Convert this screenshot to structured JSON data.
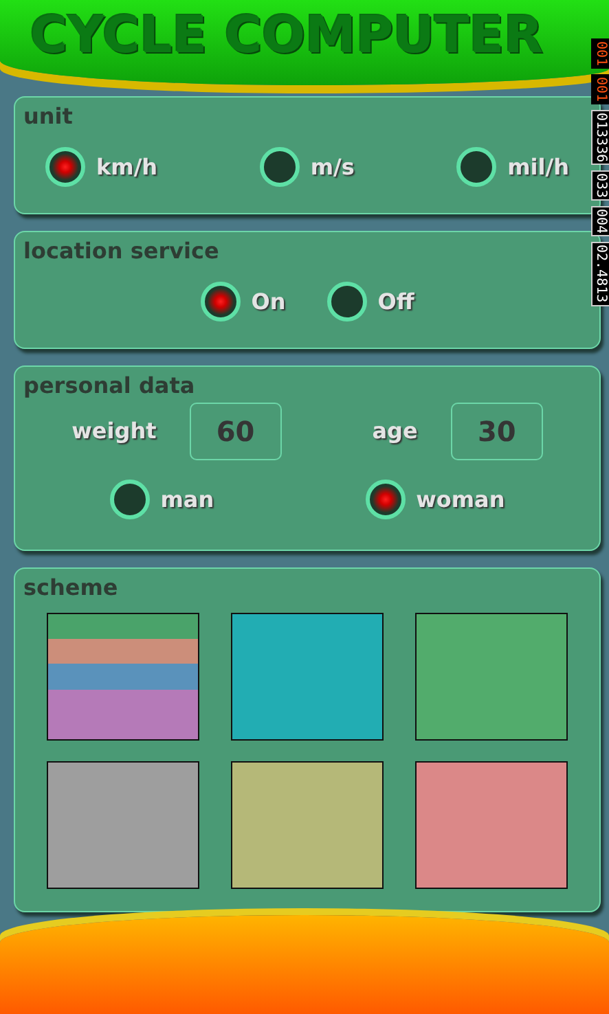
{
  "header": {
    "title": "CYCLE COMPUTER"
  },
  "counters": [
    "001",
    "001",
    "013336",
    "033",
    "004",
    "02.4813"
  ],
  "unit": {
    "title": "unit",
    "options": [
      {
        "label": "km/h",
        "selected": true
      },
      {
        "label": "m/s",
        "selected": false
      },
      {
        "label": "mil/h",
        "selected": false
      }
    ]
  },
  "location_service": {
    "title": "location service",
    "options": [
      {
        "label": "On",
        "selected": true
      },
      {
        "label": "Off",
        "selected": false
      }
    ]
  },
  "personal_data": {
    "title": "personal data",
    "fields": [
      {
        "label": "weight",
        "value": "60"
      },
      {
        "label": "age",
        "value": "30"
      }
    ],
    "gender": [
      {
        "label": "man",
        "selected": false
      },
      {
        "label": "woman",
        "selected": true
      }
    ]
  },
  "scheme": {
    "title": "scheme",
    "swatches": [
      {
        "kind": "striped",
        "stripes": [
          {
            "color": "#4aa36a"
          },
          {
            "color": "#cc8e7a"
          },
          {
            "color": "#5a92bb"
          },
          {
            "color": "#b57ab8"
          }
        ]
      },
      {
        "kind": "plain",
        "color": "#22adb3"
      },
      {
        "kind": "plain",
        "color": "#52ac6c"
      },
      {
        "kind": "plain",
        "color": "#9e9e9e"
      },
      {
        "kind": "plain",
        "color": "#b5b878"
      },
      {
        "kind": "plain",
        "color": "#db8888"
      }
    ]
  }
}
